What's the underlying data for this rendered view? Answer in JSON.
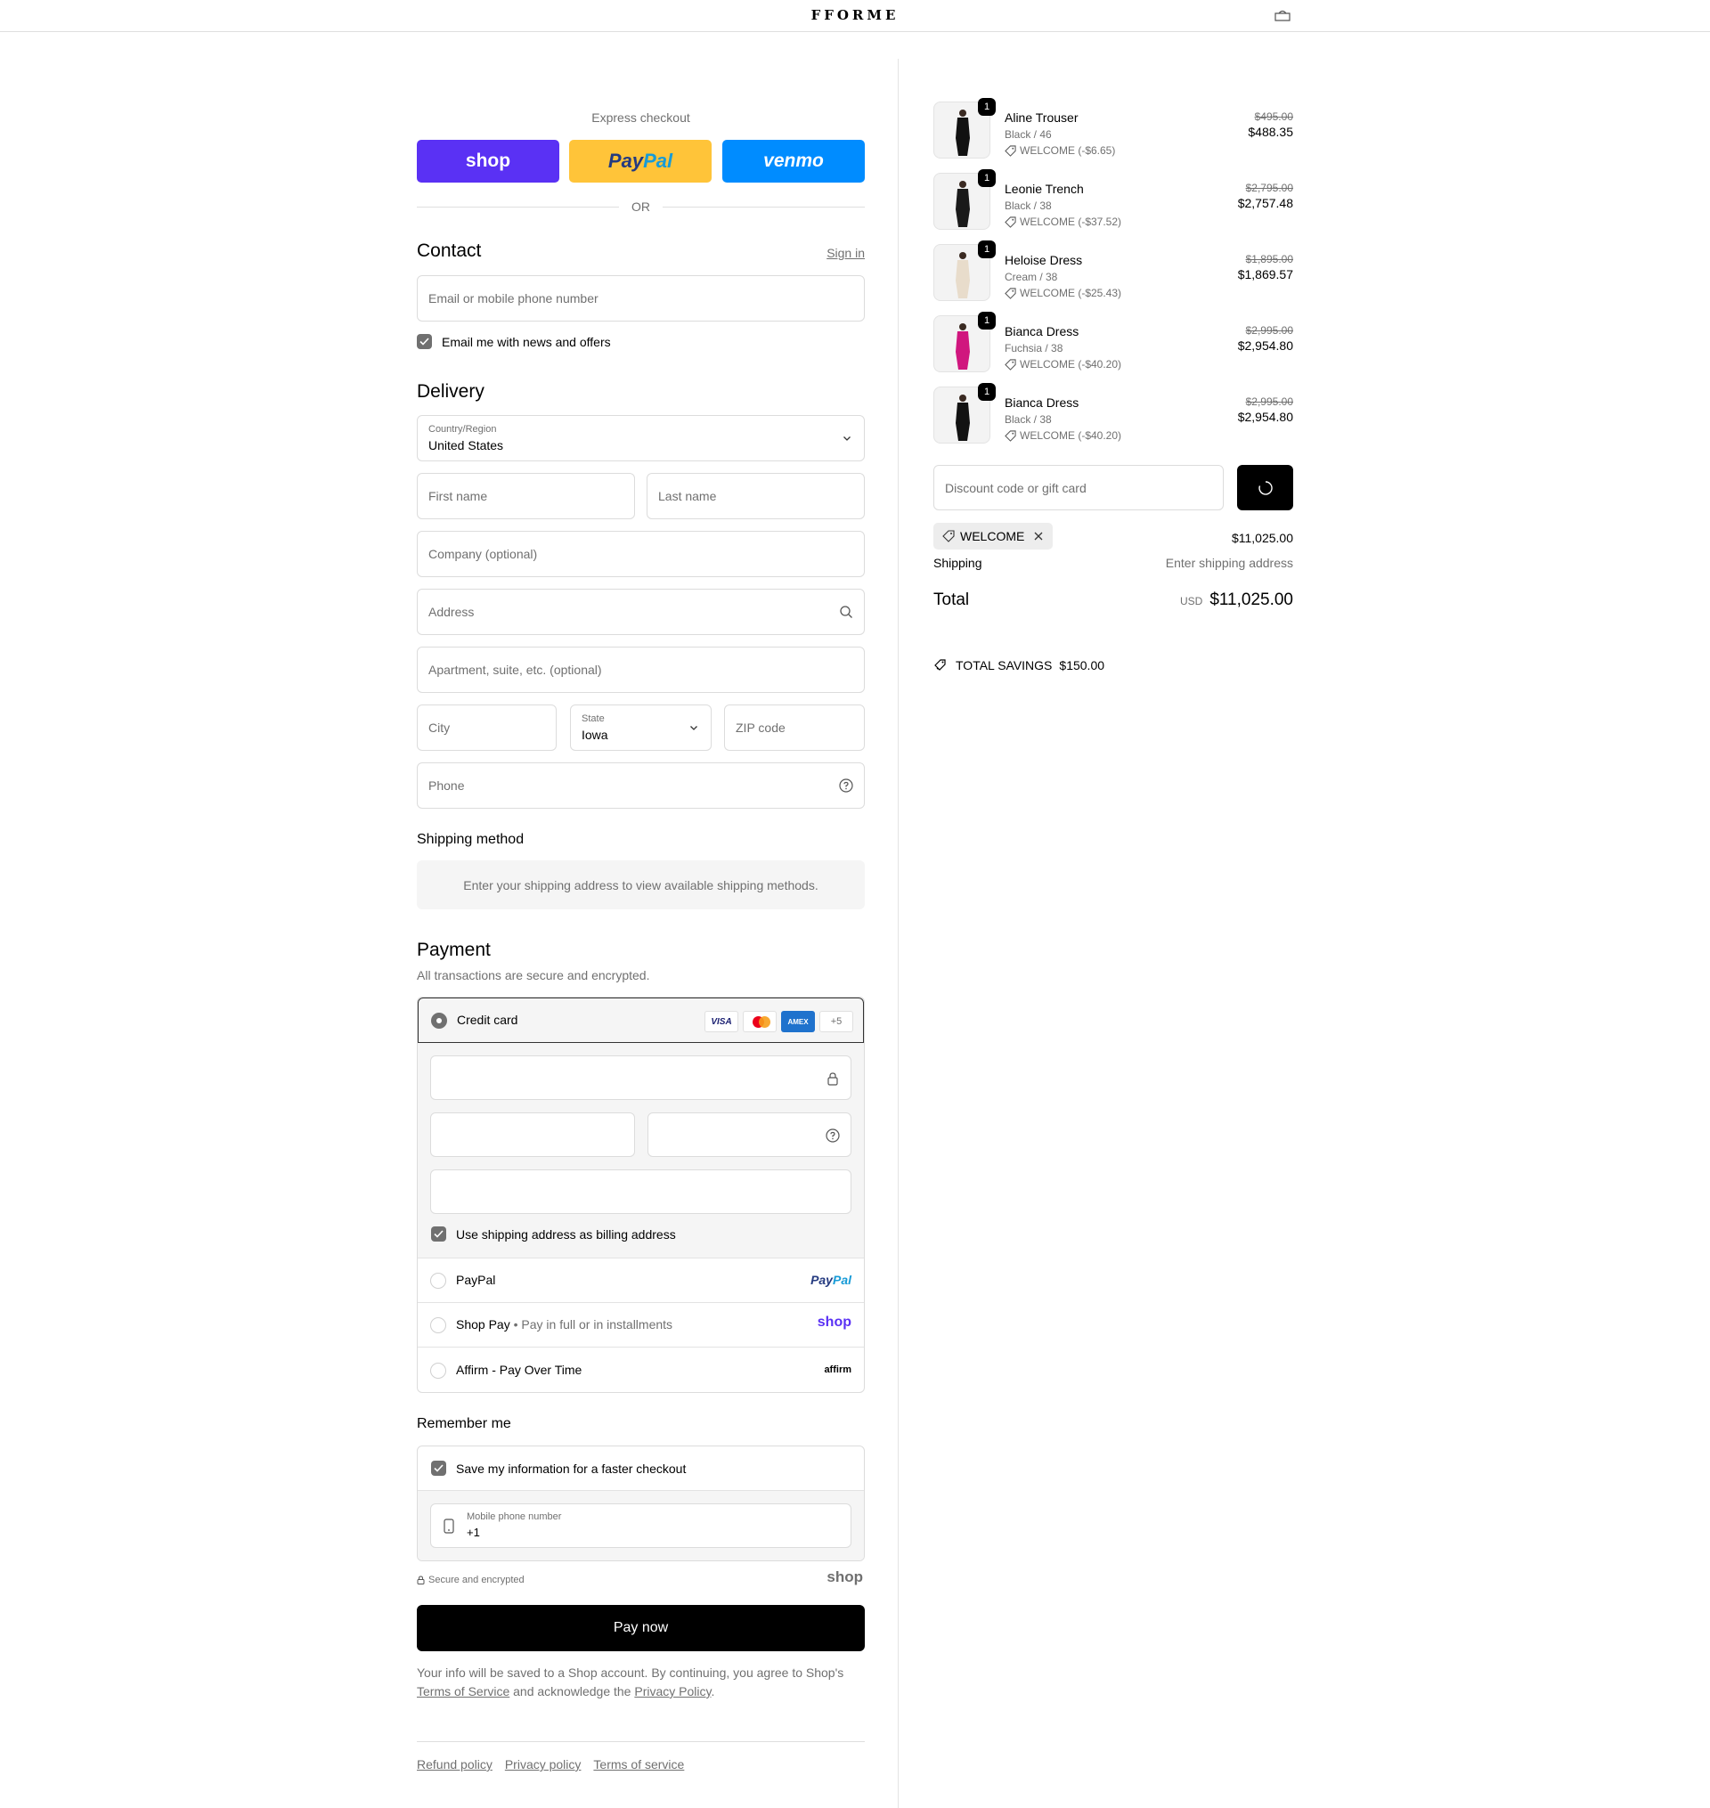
{
  "header": {
    "logo": "FFORME",
    "cart_icon": "bag-icon"
  },
  "express": {
    "title": "Express checkout",
    "shop_label": "shop",
    "paypal_label_a": "Pay",
    "paypal_label_b": "Pal",
    "venmo_label": "venmo",
    "or_label": "OR",
    "colors": {
      "shop": "#5a31f4",
      "paypal": "#ffc439",
      "venmo": "#008cff"
    }
  },
  "contact": {
    "title": "Contact",
    "sign_in": "Sign in",
    "email_placeholder": "Email or mobile phone number",
    "newsletter_label": "Email me with news and offers"
  },
  "delivery": {
    "title": "Delivery",
    "country_label": "Country/Region",
    "country_value": "United States",
    "first_name": "First name",
    "last_name": "Last name",
    "company": "Company (optional)",
    "address": "Address",
    "apartment": "Apartment, suite, etc. (optional)",
    "city": "City",
    "state_label": "State",
    "state_value": "Iowa",
    "zip": "ZIP code",
    "phone": "Phone"
  },
  "shipping_method": {
    "title": "Shipping method",
    "notice": "Enter your shipping address to view available shipping methods."
  },
  "payment": {
    "title": "Payment",
    "subtitle": "All transactions are secure and encrypted.",
    "credit_card_label": "Credit card",
    "card_brands": [
      "VISA",
      "Mastercard",
      "AMEX",
      "+5"
    ],
    "billing_same_label": "Use shipping address as billing address",
    "paypal_label": "PayPal",
    "paypal_logo_a": "Pay",
    "paypal_logo_b": "Pal",
    "shoppay_label": "Shop Pay",
    "shoppay_sub": "Pay in full or in installments",
    "shoppay_logo": "shop",
    "affirm_label": "Affirm - Pay Over Time",
    "affirm_logo": "affirm"
  },
  "remember": {
    "title": "Remember me",
    "save_label": "Save my information for a faster checkout",
    "mobile_label": "Mobile phone number",
    "mobile_value": "+1"
  },
  "footer": {
    "secure_label": "Secure and encrypted",
    "shop_logo": "shop",
    "pay_now": "Pay now",
    "legal_text_1": "Your info will be saved to a Shop account. By continuing, you agree to Shop's",
    "legal_tos": "Terms of Service",
    "legal_text_2": "and acknowledge the",
    "legal_privacy": "Privacy Policy",
    "legal_end": ".",
    "links": [
      "Refund policy",
      "Privacy policy",
      "Terms of service"
    ]
  },
  "summary": {
    "products": [
      {
        "name": "Aline Trouser",
        "variant": "Black / 46",
        "discount": "WELCOME (-$6.65)",
        "original": "$495.00",
        "final": "$488.35",
        "qty": "1",
        "color": "#111111"
      },
      {
        "name": "Leonie Trench",
        "variant": "Black / 38",
        "discount": "WELCOME (-$37.52)",
        "original": "$2,795.00",
        "final": "$2,757.48",
        "qty": "1",
        "color": "#1a1a1a"
      },
      {
        "name": "Heloise Dress",
        "variant": "Cream / 38",
        "discount": "WELCOME (-$25.43)",
        "original": "$1,895.00",
        "final": "$1,869.57",
        "qty": "1",
        "color": "#e8dccb"
      },
      {
        "name": "Bianca Dress",
        "variant": "Fuchsia / 38",
        "discount": "WELCOME (-$40.20)",
        "original": "$2,995.00",
        "final": "$2,954.80",
        "qty": "1",
        "color": "#d0167e"
      },
      {
        "name": "Bianca Dress",
        "variant": "Black / 38",
        "discount": "WELCOME (-$40.20)",
        "original": "$2,995.00",
        "final": "$2,954.80",
        "qty": "1",
        "color": "#121212"
      }
    ],
    "discount_placeholder": "Discount code or gift card",
    "applied_code": "WELCOME",
    "subtotal_value": "$11,025.00",
    "shipping_label": "Shipping",
    "shipping_value": "Enter shipping address",
    "total_label": "Total",
    "total_currency": "USD",
    "total_value": "$11,025.00",
    "savings_label": "TOTAL SAVINGS",
    "savings_value": "$150.00"
  }
}
